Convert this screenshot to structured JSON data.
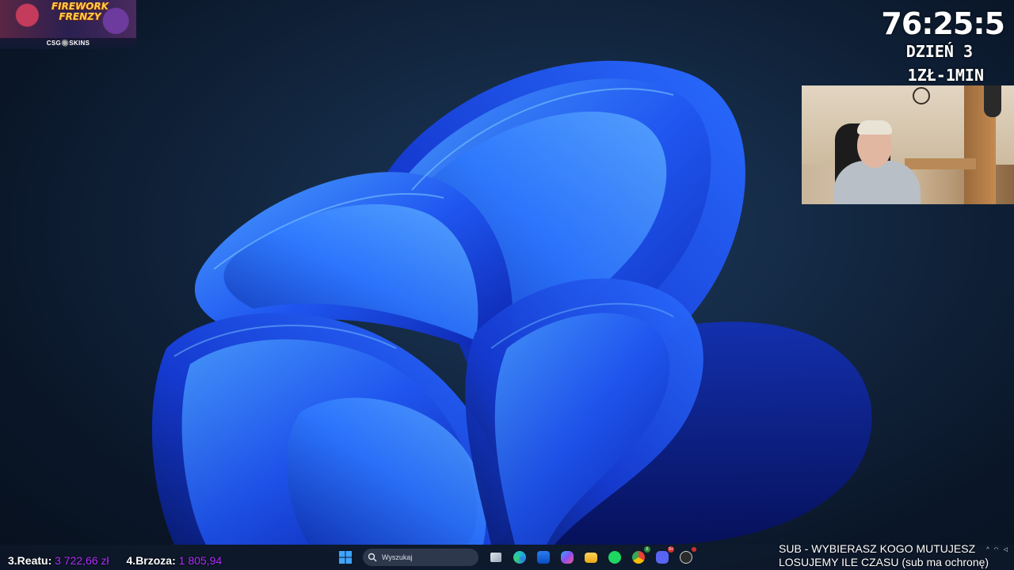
{
  "overlay": {
    "timer": "76:25:5",
    "day": "DZIEŃ 3",
    "rate": "1ZŁ-1MIN"
  },
  "sponsor": {
    "game_title": "FIREWORK FRENZY",
    "brand": "CSG🔘SKINS"
  },
  "leaderboard": [
    {
      "name": "3.Reatu:",
      "amount": "3 722,66 zł"
    },
    {
      "name": "4.Brzoza:",
      "amount": "1 805,94"
    }
  ],
  "taskbar": {
    "search_placeholder": "Wyszukaj",
    "apps": [
      "task-view",
      "edge",
      "store",
      "copilot",
      "file-explorer",
      "spotify",
      "chrome",
      "discord",
      "obs"
    ],
    "discord_badge": "9+",
    "chrome_badge": "6"
  },
  "sub_message": {
    "line1": "SUB - WYBIERASZ KOGO MUTUJESZ",
    "line2": "LOSUJEMY ILE CZASU (sub ma ochronę)"
  },
  "colors": {
    "leaderboard_amount": "#b02cff",
    "wallpaper_accent": "#1e5cff"
  }
}
